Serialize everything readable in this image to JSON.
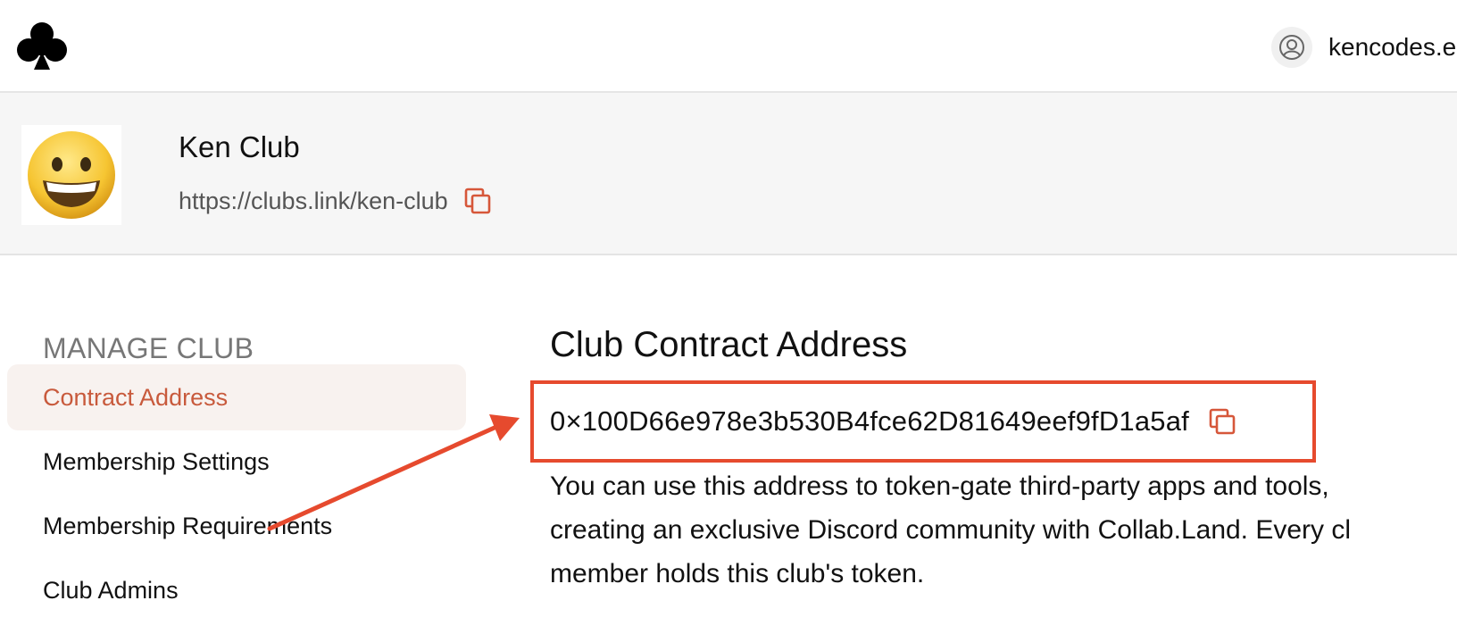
{
  "topbar": {
    "logo_icon": "club-suit-icon",
    "account_icon": "user-circle-icon",
    "account_name": "kencodes.e"
  },
  "club": {
    "avatar_icon": "grinning-face-emoji",
    "name": "Ken Club",
    "link": "https://clubs.link/ken-club",
    "copy_icon": "copy-icon"
  },
  "sidebar": {
    "heading": "MANAGE CLUB",
    "items": [
      {
        "label": "Contract Address",
        "active": true
      },
      {
        "label": "Membership Settings",
        "active": false
      },
      {
        "label": "Membership Requirements",
        "active": false
      },
      {
        "label": "Club Admins",
        "active": false
      }
    ]
  },
  "main": {
    "title": "Club Contract Address",
    "address": "0×100D66e978e3b530B4fce62D81649eef9fD1a5af",
    "copy_icon": "copy-icon",
    "description_lines": [
      "You can use this address to token-gate third-party apps and tools,",
      "creating an exclusive Discord community with Collab.Land. Every cl",
      "member holds this club's token."
    ]
  },
  "colors": {
    "accent": "#c85a3c",
    "highlight": "#e64a2e",
    "active_bg": "#f8f2ef",
    "band_bg": "#f6f6f6"
  }
}
